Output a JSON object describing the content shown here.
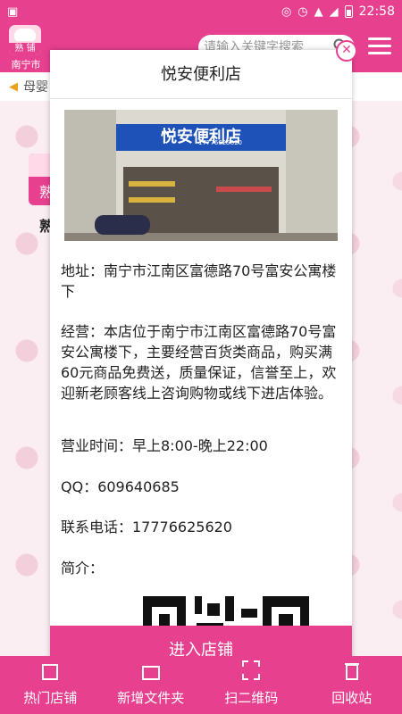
{
  "status_bar": {
    "time": "22:58",
    "icons": [
      "gallery-icon",
      "location-icon",
      "alarm-icon",
      "wifi-icon",
      "signal-icon",
      "battery-icon"
    ]
  },
  "header": {
    "logo_text": "熟 铺",
    "city": "南宁市",
    "search_placeholder": "请输入关键字搜索"
  },
  "notice": {
    "text": "母婴"
  },
  "background": {
    "tile_text": "熟",
    "tile_label": "熟"
  },
  "modal": {
    "title": "悦安便利店",
    "photo": {
      "sign_text": "悦安便利店",
      "sign_phone": "17776625620"
    },
    "address": "地址：南宁市江南区富德路70号富安公寓楼下",
    "business": "经营：本店位于南宁市江南区富德路70号富安公寓楼下，主要经营百货类商品，购买满60元商品免费送，质量保证，信誉至上，欢迎新老顾客线上咨询购物或线下进店体验。",
    "hours": "营业时间：早上8:00-晚上22:00",
    "qq": "QQ：609640685",
    "phone": "联系电话：17776625620",
    "intro": "简介：",
    "enter_button": "进入店铺"
  },
  "bottom_nav": [
    {
      "label": "热门店铺",
      "icon": "store-icon"
    },
    {
      "label": "新增文件夹",
      "icon": "folder-icon"
    },
    {
      "label": "扫二维码",
      "icon": "scan-icon"
    },
    {
      "label": "回收站",
      "icon": "trash-icon"
    }
  ],
  "colors": {
    "brand": "#e6408f",
    "background": "#fbeef2"
  }
}
